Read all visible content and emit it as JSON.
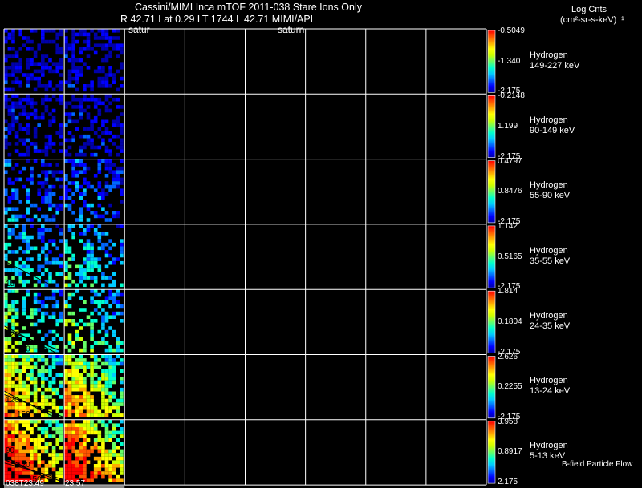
{
  "header": {
    "title": "Cassini/MIMI Inca mTOF  2011-038   Stare   Ions Only",
    "subtitle": "R        42.71 Lat 0.29 LT 1744 L         42.71  MIMI/APL",
    "saturn_label_1": "satur",
    "saturn_label_2": "saturn",
    "unit_title": "Log Cnts",
    "unit_sub": "(cm²-sr-s-keV)⁻¹"
  },
  "footer_label": "B-field Particle Flow",
  "time_ticks": [
    "038T23:49",
    "23:57"
  ],
  "colorbar_colors": [
    "#0000aa",
    "#0000ff",
    "#0066ff",
    "#00ccff",
    "#00ffcc",
    "#66ff66",
    "#ccff00",
    "#ffff00",
    "#ffaa00",
    "#ff5500",
    "#ff0000"
  ],
  "chart_data": {
    "type": "heatmap",
    "title": "Cassini/MIMI Inca mTOF  2011-038   Stare   Ions Only",
    "columns_with_data": 2,
    "total_columns": 8,
    "panels": [
      {
        "species": "Hydrogen",
        "energy": "149-227 keV",
        "cmax": "-0.5049",
        "cmid": "-1.340",
        "cmin": "-2.175",
        "level": 0.05,
        "contours": []
      },
      {
        "species": "Hydrogen",
        "energy": "90-149 keV",
        "cmax": "-0.2148",
        "cmid": "1.199",
        "cmin": "-2.175",
        "level": 0.07,
        "contours": []
      },
      {
        "species": "Hydrogen",
        "energy": "55-90 keV",
        "cmax": "0.4797",
        "cmid": "0.8476",
        "cmin": "-2.175",
        "level": 0.18,
        "contours": []
      },
      {
        "species": "Hydrogen",
        "energy": "35-55 keV",
        "cmax": "1.142",
        "cmid": "0.5165",
        "cmin": "-2.175",
        "level": 0.28,
        "contours": [
          "150"
        ]
      },
      {
        "species": "Hydrogen",
        "energy": "24-35 keV",
        "cmax": "1.814",
        "cmid": "0.1804",
        "cmin": "-2.175",
        "level": 0.38,
        "contours": [
          "120",
          "150"
        ]
      },
      {
        "species": "Hydrogen",
        "energy": "13-24 keV",
        "cmax": "2.626",
        "cmid": "0.2255",
        "cmin": "-2.175",
        "level": 0.55,
        "contours": [
          "120",
          "150"
        ]
      },
      {
        "species": "Hydrogen",
        "energy": "5-13 keV",
        "cmax": "3.958",
        "cmid": "0.8917",
        "cmin": "2.175",
        "level": 0.72,
        "contours": [
          "90",
          "120",
          "150"
        ]
      }
    ]
  }
}
